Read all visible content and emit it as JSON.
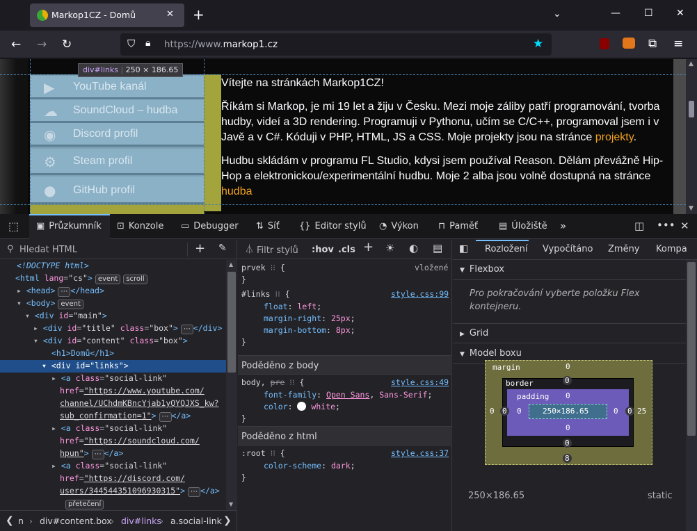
{
  "browser": {
    "tab_title": "Markop1CZ - Domů",
    "url_prefix": "https://www.",
    "url_domain": "markop1.cz"
  },
  "page": {
    "links": [
      "YouTube kanál",
      "SoundCloud – hudba",
      "Discord profil",
      "Steam profil",
      "GitHub profil"
    ],
    "highlight_tag": "div#links",
    "highlight_size": "250 × 186.65",
    "p1": "Vítejte na stránkách Markop1CZ!",
    "p2a": "Říkám si Markop, je mi 19 let a žiju v Česku. Mezi moje záliby patří programování, tvorba hudby, videí a 3D rendering. Programuji v Pythonu, učím se C/C++, programoval jsem i v Javě a v C#. Kóduji v PHP, HTML, JS a CSS. Moje projekty jsou na stránce ",
    "p2link": "projekty",
    "p2b": ".",
    "p3a": "Hudbu skládám v programu FL Studio, kdysi jsem používal Reason. Dělám převážně Hip-Hop a elektronickou/experimentální hudbu. Moje 2 alba jsou volně dostupná na stránce ",
    "p3link": "hudba"
  },
  "devtools": {
    "tabs": [
      "Průzkumník",
      "Konzole",
      "Debugger",
      "Síť",
      "Editor stylů",
      "Výkon",
      "Paměť",
      "Úložiště"
    ],
    "search_placeholder": "Hledat HTML",
    "filter_placeholder": "Filtr stylů",
    "hov": ":hov",
    "cls": ".cls",
    "layout_tabs": [
      "Rozložení",
      "Vypočítáno",
      "Změny",
      "Kompa"
    ],
    "breadcrumbs": [
      "n",
      "div#content.box",
      "div#links",
      "a.social-link"
    ],
    "badges": {
      "event": "event",
      "scroll": "scroll",
      "overflow": "přetečení",
      "dots": "⋯"
    },
    "tree": {
      "doctype": "<!DOCTYPE html>",
      "html_open": "<html",
      "lang_attr": "lang",
      "lang_val": "\"cs\"",
      "head": "<head>",
      "head_close": "</head>",
      "body": "<body>",
      "div_main": "<div",
      "id_attr": "id",
      "main_val": "\"main\"",
      "title_val": "\"title\"",
      "class_attr": "class",
      "box_val": "\"box\"",
      "close_div": "</div>",
      "content_val": "\"content\"",
      "h1": "<h1>Domů</h1>",
      "links_line": "<div id=\"links\">",
      "a_open": "<a",
      "social_val": "\"social-link\"",
      "href_attr": "href",
      "yt_href1": "\"https://www.youtube.com/",
      "yt_href2": "channel/UChdmKBncYjab1yQYQJXS_kw?",
      "yt_href3": "sub_confirmation=1\"",
      "sc_href1": "\"https://soundcloud.com/",
      "sc_href2": "hpun\"",
      "dc_href1": "\"https://discord.com/",
      "dc_href2": "users/344544351096930315\"",
      "a_close": "</a>",
      "gt": ">"
    },
    "rules": {
      "r1_sel": "prvek",
      "r1_brace": "{",
      "r1_src": "vložené",
      "close_brace": "}",
      "r2_sel": "#links",
      "r2_src": "style.css:99",
      "r2_p1": "float",
      "r2_v1": "left",
      "r2_p2": "margin-right",
      "r2_v2": "25px",
      "r2_p3": "margin-bottom",
      "r2_v3": "8px",
      "sect_body": "Poděděno z body",
      "r3_sel": "body,",
      "r3_sel2": "pre",
      "r3_src": "style.css:49",
      "r3_p1": "font-family",
      "r3_v1a": "Open Sans",
      "r3_v1b": "Sans-Serif",
      "r3_p2": "color",
      "r3_v2": "white",
      "sect_html": "Poděděno z html",
      "r4_sel": ":root",
      "r4_src": "style.css:37",
      "r4_p1": "color-scheme",
      "r4_v1": "dark"
    },
    "layout": {
      "flexbox": "Flexbox",
      "flex_hint": "Pro pokračování vyberte položku Flex kontejneru.",
      "grid": "Grid",
      "boxmodel": "Model boxu",
      "margin_label": "margin",
      "border_label": "border",
      "padding_label": "padding",
      "content_size": "250×186.65",
      "m_top": "0",
      "m_right": "25",
      "m_bottom": "8",
      "m_left": "0",
      "b_top": "0",
      "b_right": "0",
      "b_bottom": "0",
      "b_left": "0",
      "p_top": "0",
      "p_right": "0",
      "p_bottom": "0",
      "p_left": "0",
      "dims": "250×186.65",
      "position": "static"
    }
  }
}
